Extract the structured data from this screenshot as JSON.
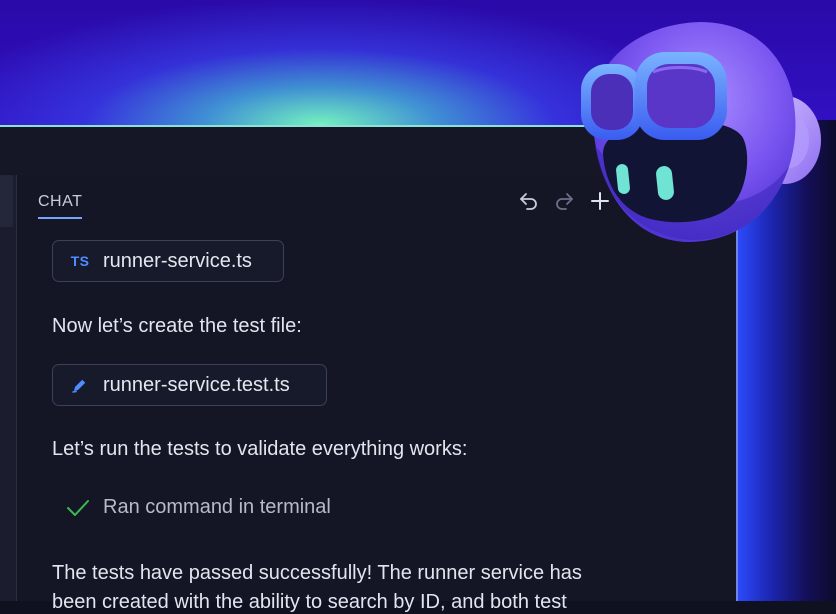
{
  "chat": {
    "tab_label": "CHAT",
    "toolbar": {
      "undo_icon": "undo-icon",
      "redo_icon": "redo-icon",
      "new_icon": "plus-icon"
    },
    "messages": [
      {
        "kind": "file",
        "icon": "ts-file-icon",
        "badge": "TS",
        "label": "runner-service.ts"
      },
      {
        "kind": "text",
        "text": "Now let’s create the test file:"
      },
      {
        "kind": "file",
        "icon": "edit-pencil-icon",
        "label": "runner-service.test.ts"
      },
      {
        "kind": "text",
        "text": "Let’s run the tests to validate everything works:"
      },
      {
        "kind": "command",
        "icon": "check-icon",
        "label": "Ran command in terminal"
      },
      {
        "kind": "text",
        "text": "The tests have passed successfully! The runner service has"
      },
      {
        "kind": "text",
        "text": "been created with the ability to search by ID, and both test"
      }
    ]
  },
  "colors": {
    "accent": "#7aa2ff",
    "ts_badge": "#4f8cff",
    "check": "#3fb950",
    "panel_bg": "#141626"
  },
  "mascot": {
    "icon": "copilot-mascot-icon"
  }
}
